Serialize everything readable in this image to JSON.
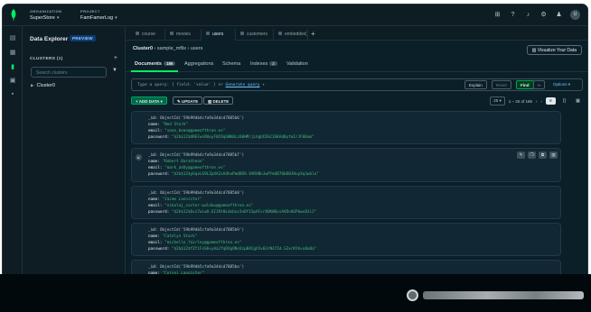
{
  "topbar": {
    "org_label": "ORGANIZATION",
    "org_value": "SuperStore",
    "project_label": "PROJECT",
    "project_value": "FamFamerLog",
    "icons": [
      "grid-icon",
      "help-icon",
      "bell-icon",
      "gear-icon",
      "person-icon"
    ],
    "avatar": "U"
  },
  "rail": {
    "icons": [
      "database-icon",
      "document-icon",
      "chart-icon",
      "terminal-icon",
      "lock-icon"
    ]
  },
  "explorer": {
    "title": "Data Explorer",
    "badge": "PREVIEW",
    "clusters_label": "CLUSTERS (1)",
    "search_placeholder": "Search clusters",
    "cluster_name": "Cluster0"
  },
  "workspace_tabs": [
    {
      "label": "course"
    },
    {
      "label": "movies"
    },
    {
      "label": "users"
    },
    {
      "label": "customers"
    },
    {
      "label": "embedded_movies"
    }
  ],
  "breadcrumb": {
    "cluster": "Cluster0",
    "database": "sample_mflix",
    "collection": "users"
  },
  "visualize_button": "Visualize Your Data",
  "subtabs": {
    "documents": "Documents",
    "documents_count": "186",
    "aggregations": "Aggregations",
    "schema": "Schema",
    "indexes": "Indexes",
    "indexes_count": "2",
    "validation": "Validation"
  },
  "query": {
    "placeholder_prefix": "Type a query: { field: 'value' } or ",
    "link_text": "Generate query",
    "explain": "Explain",
    "reset": "Reset",
    "find": "Find",
    "options": "Options ▾"
  },
  "actions": {
    "add_data": "+ ADD DATA ▾",
    "update": "UPDATE",
    "delete": "DELETE",
    "page_size": "25 ▾",
    "range": "1 – 25 of 186"
  },
  "documents": [
    {
      "id": "ObjectId('59b99db4cfa9a34dcd7885b6')",
      "name": "\"Ned Stark\"",
      "email": "\"sean_bean@gameofthron.es\"",
      "password": "\"$2b$12$UREFwsRUoyF0CRqGNK0LzO0HM/jLhgUCDGCIGKAd0yfmIrJF6Kam\""
    },
    {
      "id": "ObjectId('59b99db4cfa9a34dcd7885b7')",
      "name": "\"Robert Baratheon\"",
      "email": "\"mark_addy@gameofthron.es\"",
      "password": "\"$2b$12$yGqxLG9LZpXA2xVdhuPmdDD9.VARXNnJwPYm4B76bD0JHuyXq3wbla\""
    },
    {
      "id": "ObjectId('59b99db4cfa9a34dcd7885b8')",
      "name": "\"Jaime Lannister\"",
      "email": "\"nikolaj_coster-waldau@gameofthron.es\"",
      "password": "\"$2b$12$6vz7wiwO.EI1Rt0Ldxbuz3nDf1SpAFcr8UKWQxsAVDndGPkwx8Ji2\""
    },
    {
      "id": "ObjectId('59b99db5cfa9a34dcd7885b9')",
      "name": "\"Catelyn Stark\"",
      "email": "\"michelle_fairley@gameofthron.es\"",
      "password": "\"$2b$12$fZfiFoS6vyAaJfqDXg9NsOzpB4Cgh5v03rN47Id.SZxrK5hvx8o8a\""
    },
    {
      "id": "ObjectId('59b99db5cfa9a34dcd7885ba')",
      "name": "\"Cersei Lannister\"",
      "email": "\"lena_headey@gameofthron.es\"",
      "password": ""
    }
  ],
  "colors": {
    "accent": "#00ed64",
    "background": "#0b1f29",
    "panel": "#0e1c24",
    "card": "#112733"
  }
}
